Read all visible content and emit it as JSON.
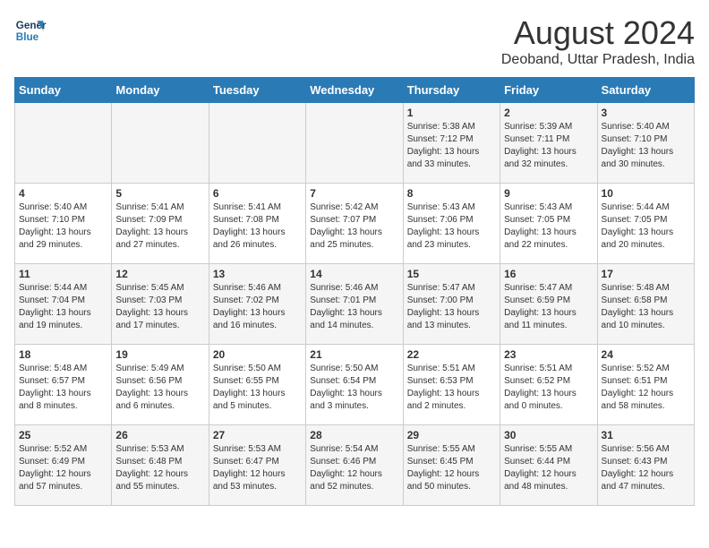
{
  "header": {
    "logo_line1": "General",
    "logo_line2": "Blue",
    "title": "August 2024",
    "subtitle": "Deoband, Uttar Pradesh, India"
  },
  "weekdays": [
    "Sunday",
    "Monday",
    "Tuesday",
    "Wednesday",
    "Thursday",
    "Friday",
    "Saturday"
  ],
  "weeks": [
    [
      {
        "day": "",
        "info": ""
      },
      {
        "day": "",
        "info": ""
      },
      {
        "day": "",
        "info": ""
      },
      {
        "day": "",
        "info": ""
      },
      {
        "day": "1",
        "info": "Sunrise: 5:38 AM\nSunset: 7:12 PM\nDaylight: 13 hours\nand 33 minutes."
      },
      {
        "day": "2",
        "info": "Sunrise: 5:39 AM\nSunset: 7:11 PM\nDaylight: 13 hours\nand 32 minutes."
      },
      {
        "day": "3",
        "info": "Sunrise: 5:40 AM\nSunset: 7:10 PM\nDaylight: 13 hours\nand 30 minutes."
      }
    ],
    [
      {
        "day": "4",
        "info": "Sunrise: 5:40 AM\nSunset: 7:10 PM\nDaylight: 13 hours\nand 29 minutes."
      },
      {
        "day": "5",
        "info": "Sunrise: 5:41 AM\nSunset: 7:09 PM\nDaylight: 13 hours\nand 27 minutes."
      },
      {
        "day": "6",
        "info": "Sunrise: 5:41 AM\nSunset: 7:08 PM\nDaylight: 13 hours\nand 26 minutes."
      },
      {
        "day": "7",
        "info": "Sunrise: 5:42 AM\nSunset: 7:07 PM\nDaylight: 13 hours\nand 25 minutes."
      },
      {
        "day": "8",
        "info": "Sunrise: 5:43 AM\nSunset: 7:06 PM\nDaylight: 13 hours\nand 23 minutes."
      },
      {
        "day": "9",
        "info": "Sunrise: 5:43 AM\nSunset: 7:05 PM\nDaylight: 13 hours\nand 22 minutes."
      },
      {
        "day": "10",
        "info": "Sunrise: 5:44 AM\nSunset: 7:05 PM\nDaylight: 13 hours\nand 20 minutes."
      }
    ],
    [
      {
        "day": "11",
        "info": "Sunrise: 5:44 AM\nSunset: 7:04 PM\nDaylight: 13 hours\nand 19 minutes."
      },
      {
        "day": "12",
        "info": "Sunrise: 5:45 AM\nSunset: 7:03 PM\nDaylight: 13 hours\nand 17 minutes."
      },
      {
        "day": "13",
        "info": "Sunrise: 5:46 AM\nSunset: 7:02 PM\nDaylight: 13 hours\nand 16 minutes."
      },
      {
        "day": "14",
        "info": "Sunrise: 5:46 AM\nSunset: 7:01 PM\nDaylight: 13 hours\nand 14 minutes."
      },
      {
        "day": "15",
        "info": "Sunrise: 5:47 AM\nSunset: 7:00 PM\nDaylight: 13 hours\nand 13 minutes."
      },
      {
        "day": "16",
        "info": "Sunrise: 5:47 AM\nSunset: 6:59 PM\nDaylight: 13 hours\nand 11 minutes."
      },
      {
        "day": "17",
        "info": "Sunrise: 5:48 AM\nSunset: 6:58 PM\nDaylight: 13 hours\nand 10 minutes."
      }
    ],
    [
      {
        "day": "18",
        "info": "Sunrise: 5:48 AM\nSunset: 6:57 PM\nDaylight: 13 hours\nand 8 minutes."
      },
      {
        "day": "19",
        "info": "Sunrise: 5:49 AM\nSunset: 6:56 PM\nDaylight: 13 hours\nand 6 minutes."
      },
      {
        "day": "20",
        "info": "Sunrise: 5:50 AM\nSunset: 6:55 PM\nDaylight: 13 hours\nand 5 minutes."
      },
      {
        "day": "21",
        "info": "Sunrise: 5:50 AM\nSunset: 6:54 PM\nDaylight: 13 hours\nand 3 minutes."
      },
      {
        "day": "22",
        "info": "Sunrise: 5:51 AM\nSunset: 6:53 PM\nDaylight: 13 hours\nand 2 minutes."
      },
      {
        "day": "23",
        "info": "Sunrise: 5:51 AM\nSunset: 6:52 PM\nDaylight: 13 hours\nand 0 minutes."
      },
      {
        "day": "24",
        "info": "Sunrise: 5:52 AM\nSunset: 6:51 PM\nDaylight: 12 hours\nand 58 minutes."
      }
    ],
    [
      {
        "day": "25",
        "info": "Sunrise: 5:52 AM\nSunset: 6:49 PM\nDaylight: 12 hours\nand 57 minutes."
      },
      {
        "day": "26",
        "info": "Sunrise: 5:53 AM\nSunset: 6:48 PM\nDaylight: 12 hours\nand 55 minutes."
      },
      {
        "day": "27",
        "info": "Sunrise: 5:53 AM\nSunset: 6:47 PM\nDaylight: 12 hours\nand 53 minutes."
      },
      {
        "day": "28",
        "info": "Sunrise: 5:54 AM\nSunset: 6:46 PM\nDaylight: 12 hours\nand 52 minutes."
      },
      {
        "day": "29",
        "info": "Sunrise: 5:55 AM\nSunset: 6:45 PM\nDaylight: 12 hours\nand 50 minutes."
      },
      {
        "day": "30",
        "info": "Sunrise: 5:55 AM\nSunset: 6:44 PM\nDaylight: 12 hours\nand 48 minutes."
      },
      {
        "day": "31",
        "info": "Sunrise: 5:56 AM\nSunset: 6:43 PM\nDaylight: 12 hours\nand 47 minutes."
      }
    ]
  ]
}
